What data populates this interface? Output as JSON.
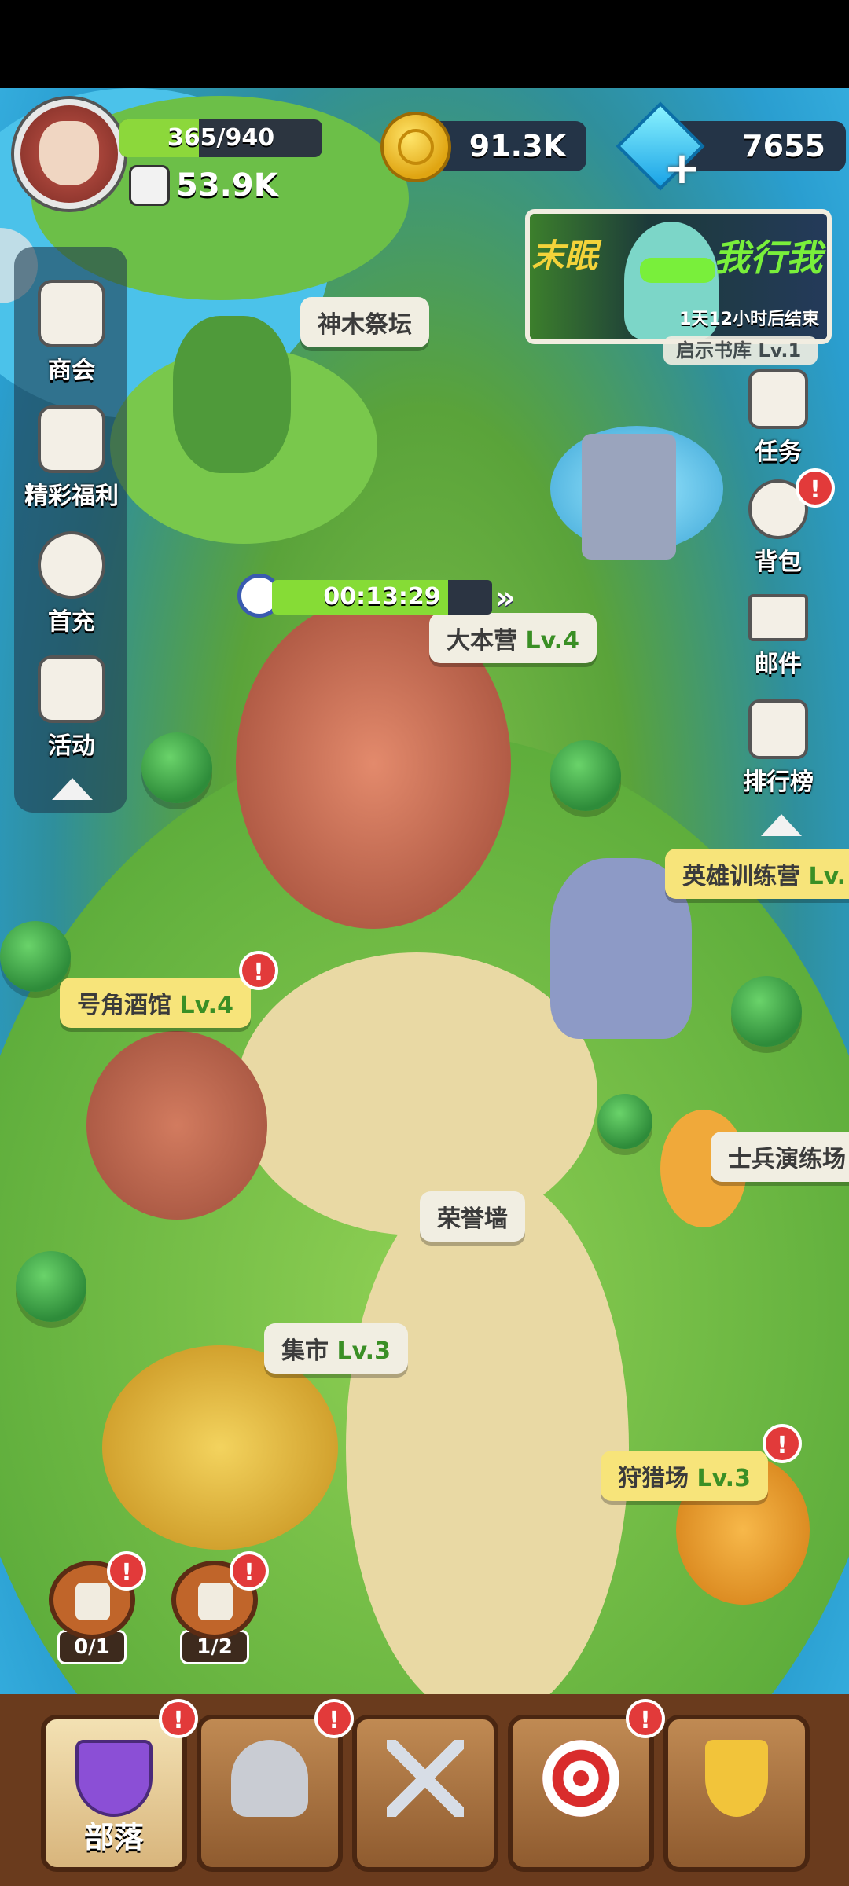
{
  "hud": {
    "exp_text": "365/940",
    "exp_progress": 0.39,
    "power": "53.9K",
    "coins": "91.3K",
    "gems": "7655"
  },
  "event_banner": {
    "title_left": "末眠",
    "title_right": "我行我",
    "countdown": "1天12小时后结束",
    "peek_label": "启示书库 Lv.1"
  },
  "left_menu": {
    "items": [
      {
        "label": "商会",
        "icon": "shop-icon"
      },
      {
        "label": "精彩福利",
        "icon": "gift-box-icon"
      },
      {
        "label": "首充",
        "icon": "first-recharge-icon"
      },
      {
        "label": "活动",
        "icon": "activity-cards-icon"
      }
    ]
  },
  "right_menu": {
    "items": [
      {
        "label": "任务",
        "icon": "quest-scroll-icon"
      },
      {
        "label": "背包",
        "icon": "backpack-icon"
      },
      {
        "label": "邮件",
        "icon": "mail-icon"
      },
      {
        "label": "排行榜",
        "icon": "leaderboard-icon"
      }
    ]
  },
  "timer": {
    "text": "00:13:29",
    "progress": 0.8
  },
  "buildings": {
    "shrine": {
      "name": "神木祭坛"
    },
    "town_hall": {
      "name": "大本营",
      "level": "Lv.4"
    },
    "hero_camp": {
      "name": "英雄训练营",
      "level": "Lv."
    },
    "tavern": {
      "name": "号角酒馆",
      "level": "Lv.4"
    },
    "drill_ground": {
      "name": "士兵演练场"
    },
    "honor_wall": {
      "name": "荣誉墙"
    },
    "market": {
      "name": "集市",
      "level": "Lv.3"
    },
    "hunting": {
      "name": "狩猎场",
      "level": "Lv.3"
    }
  },
  "quick_buttons": [
    {
      "count": "0/1",
      "icon": "star-book-icon"
    },
    {
      "count": "1/2",
      "icon": "tools-icon"
    }
  ],
  "alert_mark": "!",
  "bottom_nav": [
    {
      "label": "部落",
      "icon": "tribe-shield-icon",
      "active": true
    },
    {
      "label": "",
      "icon": "viking-helmet-icon"
    },
    {
      "label": "",
      "icon": "crossed-swords-icon"
    },
    {
      "label": "",
      "icon": "target-icon"
    },
    {
      "label": "",
      "icon": "trophy-icon"
    }
  ],
  "colors": {
    "accent_green": "#8cd83b",
    "alert_red": "#e23a3a",
    "label_yellow": "#f7e47a",
    "level_green": "#3a8f25"
  }
}
